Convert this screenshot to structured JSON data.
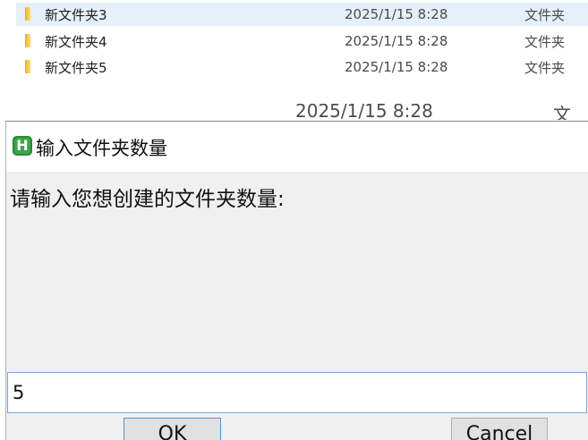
{
  "explorer": {
    "rows": [
      {
        "name": "新文件夹3",
        "date": "2025/1/15 8:28",
        "type": "文件夹",
        "selected": true
      },
      {
        "name": "新文件夹4",
        "date": "2025/1/15 8:28",
        "type": "文件夹",
        "selected": false
      },
      {
        "name": "新文件夹5",
        "date": "2025/1/15 8:28",
        "type": "文件夹",
        "selected": false
      }
    ],
    "partial_row": {
      "date": "2025/1/15 8:28",
      "type": "文件夹"
    }
  },
  "dialog": {
    "title": "输入文件夹数量",
    "app_icon_letter": "H",
    "prompt": "请输入您想创建的文件夹数量:",
    "input_value": "5",
    "ok_label": "OK",
    "cancel_label": "Cancel"
  },
  "colors": {
    "selected_row": "#e5f0fb",
    "folder_icon": "#f5cd5b",
    "dialog_background": "#f0f0f0",
    "app_icon": "#3aa64a",
    "input_border": "#7aa7d8",
    "ok_border": "#5a90cf"
  }
}
